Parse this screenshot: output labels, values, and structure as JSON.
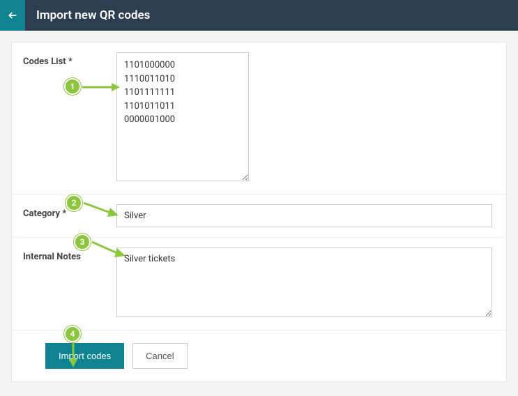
{
  "header": {
    "title": "Import new QR codes"
  },
  "fields": {
    "codes": {
      "label": "Codes List *",
      "value": "1101000000\n1110011010\n1101111111\n1101011011\n0000001000"
    },
    "category": {
      "label": "Category *",
      "value": "Silver"
    },
    "notes": {
      "label": "Internal Notes",
      "value": "Silver tickets"
    }
  },
  "actions": {
    "submit": "Import codes",
    "cancel": "Cancel"
  },
  "callouts": {
    "c1": "1",
    "c2": "2",
    "c3": "3",
    "c4": "4"
  }
}
